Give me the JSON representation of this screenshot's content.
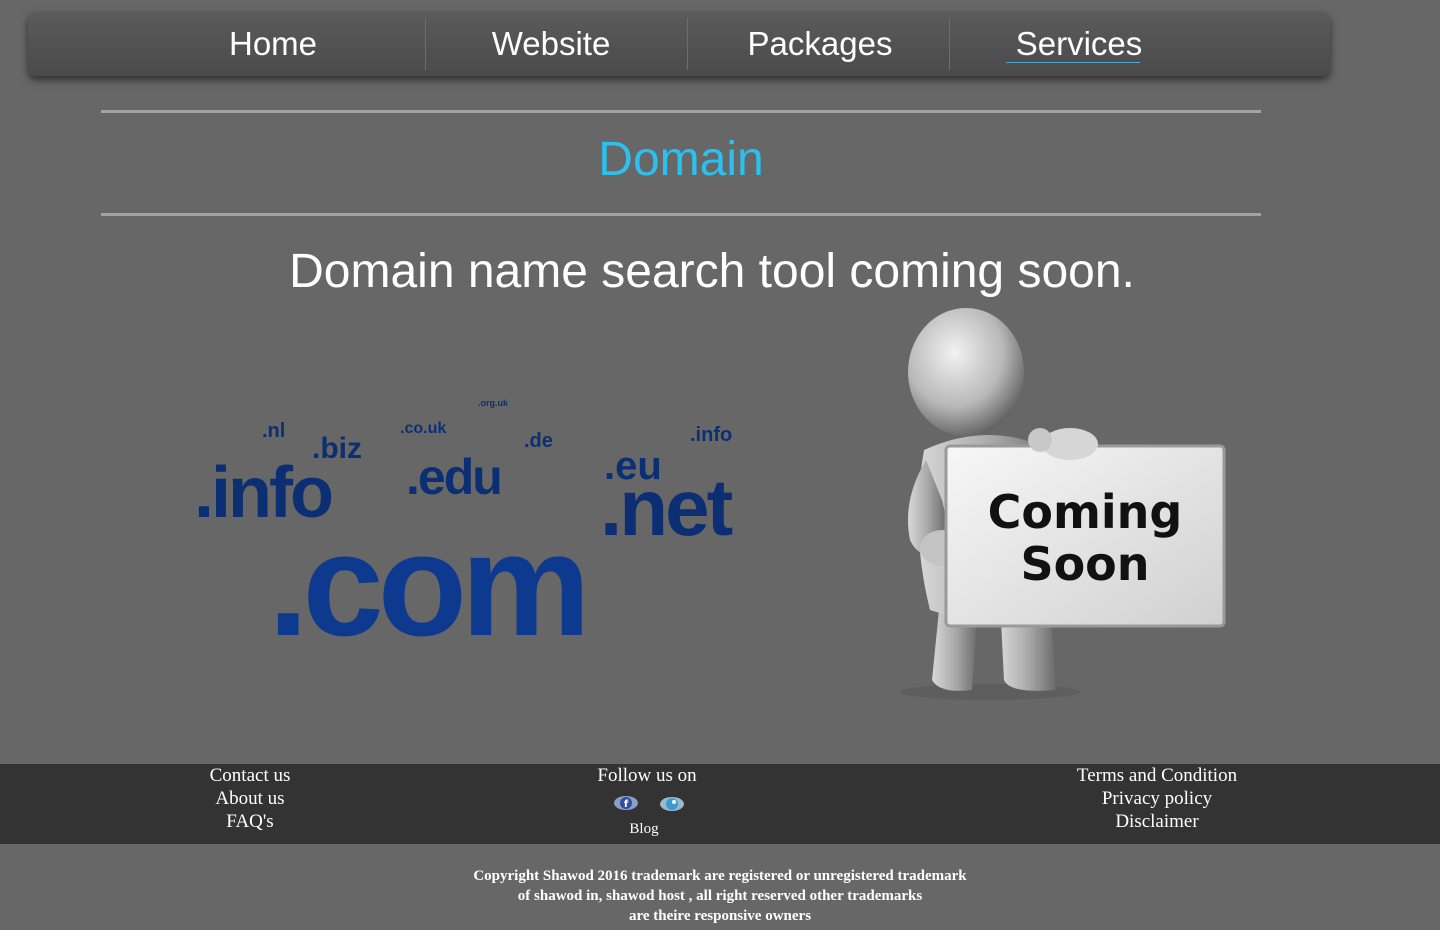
{
  "nav": {
    "items": [
      {
        "label": "Home"
      },
      {
        "label": "Website"
      },
      {
        "label": "Packages"
      },
      {
        "label": "Services"
      }
    ]
  },
  "main": {
    "title": "Domain",
    "subtitle": "Domain name search tool coming soon.",
    "domain_graphic": {
      "tlds": [
        ".nl",
        ".biz",
        ".co.uk",
        ".org.uk",
        ".de",
        ".info",
        ".info",
        ".edu",
        ".eu",
        ".net",
        ".com"
      ]
    },
    "coming_soon_sign": {
      "line1": "Coming",
      "line2": "Soon"
    }
  },
  "footer": {
    "left_links": [
      {
        "label": "Contact us"
      },
      {
        "label": "About us"
      },
      {
        "label": "FAQ's"
      }
    ],
    "follow_label": "Follow us on",
    "social": [
      {
        "icon": "facebook-icon",
        "letter": "f"
      },
      {
        "icon": "twitter-icon"
      }
    ],
    "blog_label": "Blog",
    "right_links": [
      {
        "label": "Terms and Condition"
      },
      {
        "label": "Privacy policy"
      },
      {
        "label": "Disclaimer"
      }
    ]
  },
  "copyright": {
    "line1": "Copyright Shawod 2016 trademark are registered or unregistered trademark",
    "line2": "of shawod in, shawod host , all right reserved other trademarks",
    "line3": "are theire responsive owners"
  },
  "colors": {
    "background": "#676767",
    "accent": "#2cc0ee",
    "footer": "#333333",
    "domain_text": "#0c2f73"
  }
}
